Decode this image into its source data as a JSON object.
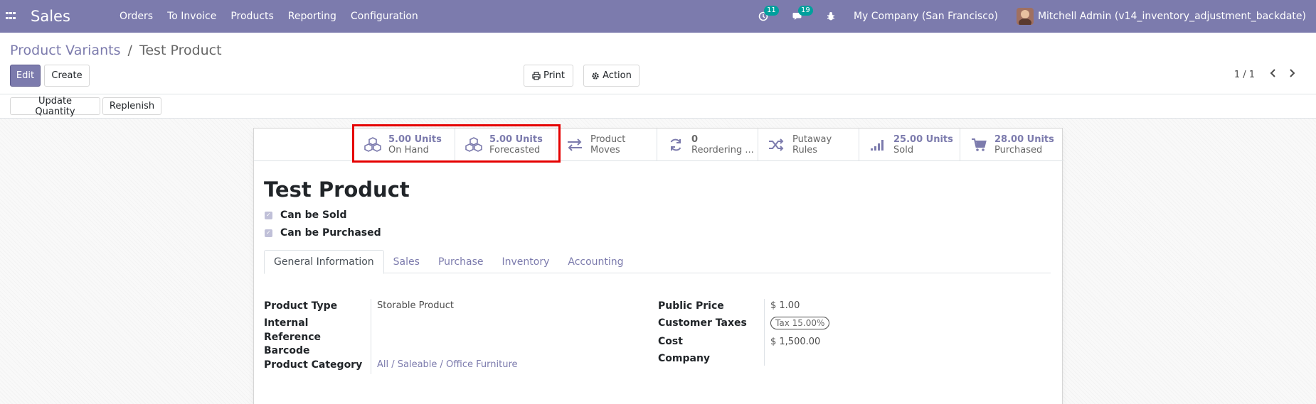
{
  "navbar": {
    "app_name": "Sales",
    "menu": [
      "Orders",
      "To Invoice",
      "Products",
      "Reporting",
      "Configuration"
    ],
    "activity_count": "11",
    "message_count": "19",
    "company": "My Company (San Francisco)",
    "user": "Mitchell Admin (v14_inventory_adjustment_backdate)",
    "color": "#7c7bad"
  },
  "breadcrumb": {
    "parent": "Product Variants",
    "separator": "/",
    "current": "Test Product"
  },
  "buttons": {
    "edit": "Edit",
    "create": "Create",
    "print": "Print",
    "action": "Action",
    "update_quantity": "Update Quantity",
    "replenish": "Replenish"
  },
  "pager": {
    "value": "1 / 1"
  },
  "stat_buttons": [
    {
      "value": "5.00 Units",
      "label": "On Hand",
      "icon": "cubes-icon"
    },
    {
      "value": "5.00 Units",
      "label": "Forecasted",
      "icon": "cubes-icon"
    },
    {
      "value": "Product",
      "label": "Moves",
      "icon": "exchange-icon"
    },
    {
      "value": "0",
      "label": "Reordering ...",
      "icon": "refresh-icon"
    },
    {
      "value": "Putaway",
      "label": "Rules",
      "icon": "random-icon"
    },
    {
      "value": "25.00 Units",
      "label": "Sold",
      "icon": "signal-icon"
    },
    {
      "value": "28.00 Units",
      "label": "Purchased",
      "icon": "cart-icon"
    }
  ],
  "product": {
    "name": "Test Product",
    "can_be_sold": "Can be Sold",
    "can_be_purchased": "Can be Purchased"
  },
  "tabs": [
    "General Information",
    "Sales",
    "Purchase",
    "Inventory",
    "Accounting"
  ],
  "fields_left": {
    "product_type_label": "Product Type",
    "product_type_value": "Storable Product",
    "internal_reference_label_1": "Internal",
    "internal_reference_label_2": "Reference",
    "barcode_label": "Barcode",
    "category_label": "Product Category",
    "category_value": "All / Saleable / Office Furniture"
  },
  "fields_right": {
    "public_price_label": "Public Price",
    "public_price_value": "$ 1.00",
    "customer_taxes_label": "Customer Taxes",
    "customer_taxes_value": "Tax 15.00%",
    "cost_label": "Cost",
    "cost_value": "$ 1,500.00",
    "company_label": "Company"
  }
}
